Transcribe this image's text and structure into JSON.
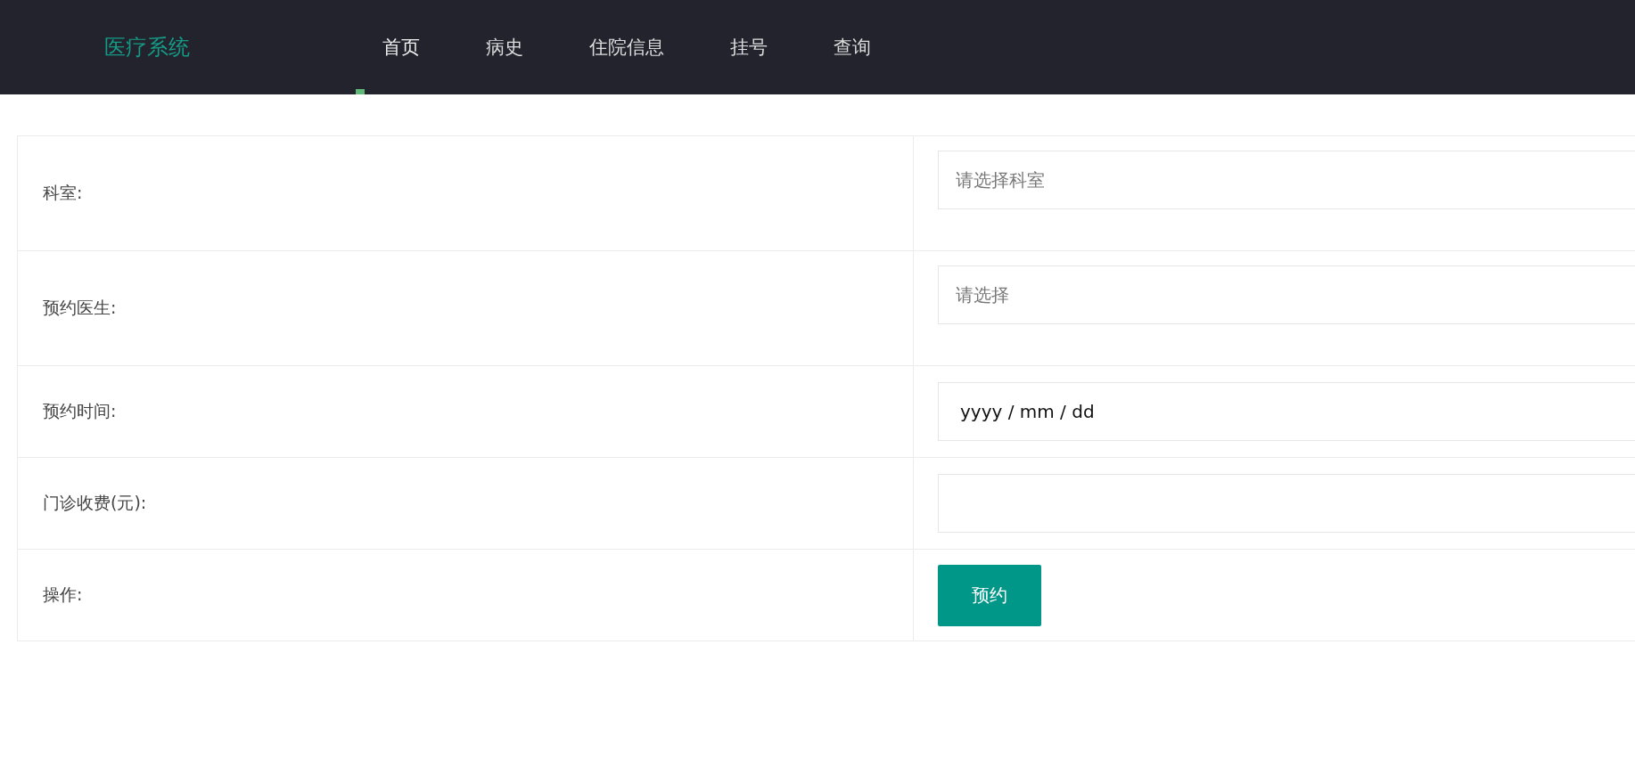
{
  "header": {
    "logo": "医疗系统",
    "nav": [
      {
        "label": "首页",
        "selected": true
      },
      {
        "label": "病史",
        "selected": false
      },
      {
        "label": "住院信息",
        "selected": false
      },
      {
        "label": "挂号",
        "selected": false
      },
      {
        "label": "查询",
        "selected": false
      }
    ]
  },
  "form": {
    "rows": [
      {
        "label": "科室:",
        "kind": "select",
        "placeholder": "请选择科室"
      },
      {
        "label": "预约医生:",
        "kind": "select",
        "placeholder": "请选择"
      },
      {
        "label": "预约时间:",
        "kind": "date",
        "value": "yyyy / mm / dd"
      },
      {
        "label": "门诊收费(元):",
        "kind": "text"
      },
      {
        "label": "操作:",
        "kind": "button",
        "button": "预约"
      }
    ]
  }
}
